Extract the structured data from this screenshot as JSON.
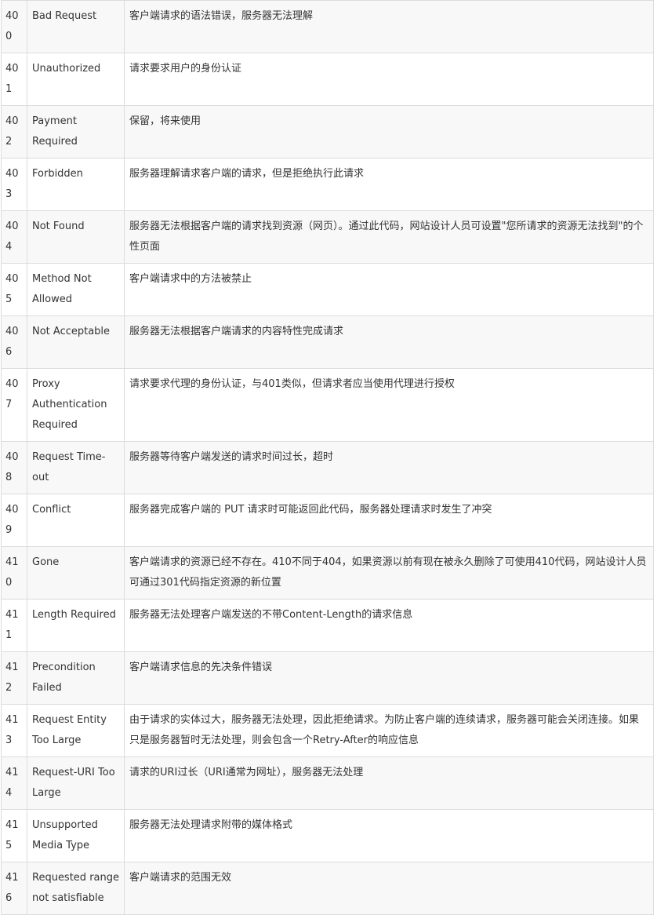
{
  "rows": [
    {
      "code": "400",
      "name": "Bad Request",
      "desc": "客户端请求的语法错误，服务器无法理解"
    },
    {
      "code": "401",
      "name": "Unauthorized",
      "desc": "请求要求用户的身份认证"
    },
    {
      "code": "402",
      "name": "Payment Required",
      "desc": "保留，将来使用"
    },
    {
      "code": "403",
      "name": "Forbidden",
      "desc": "服务器理解请求客户端的请求，但是拒绝执行此请求"
    },
    {
      "code": "404",
      "name": "Not Found",
      "desc": "服务器无法根据客户端的请求找到资源（网页）。通过此代码，网站设计人员可设置\"您所请求的资源无法找到\"的个性页面"
    },
    {
      "code": "405",
      "name": "Method Not Allowed",
      "desc": "客户端请求中的方法被禁止"
    },
    {
      "code": "406",
      "name": "Not Acceptable",
      "desc": "服务器无法根据客户端请求的内容特性完成请求"
    },
    {
      "code": "407",
      "name": "Proxy Authentication Required",
      "desc": "请求要求代理的身份认证，与401类似，但请求者应当使用代理进行授权"
    },
    {
      "code": "408",
      "name": "Request Time-out",
      "desc": "服务器等待客户端发送的请求时间过长，超时"
    },
    {
      "code": "409",
      "name": "Conflict",
      "desc": "服务器完成客户端的 PUT 请求时可能返回此代码，服务器处理请求时发生了冲突"
    },
    {
      "code": "410",
      "name": "Gone",
      "desc": "客户端请求的资源已经不存在。410不同于404，如果资源以前有现在被永久删除了可使用410代码，网站设计人员可通过301代码指定资源的新位置"
    },
    {
      "code": "411",
      "name": "Length Required",
      "desc": "服务器无法处理客户端发送的不带Content-Length的请求信息"
    },
    {
      "code": "412",
      "name": "Precondition Failed",
      "desc": "客户端请求信息的先决条件错误"
    },
    {
      "code": "413",
      "name": "Request Entity Too Large",
      "desc": "由于请求的实体过大，服务器无法处理，因此拒绝请求。为防止客户端的连续请求，服务器可能会关闭连接。如果只是服务器暂时无法处理，则会包含一个Retry-After的响应信息"
    },
    {
      "code": "414",
      "name": "Request-URI Too Large",
      "desc": "请求的URI过长（URI通常为网址），服务器无法处理"
    },
    {
      "code": "415",
      "name": "Unsupported Media Type",
      "desc": "服务器无法处理请求附带的媒体格式"
    },
    {
      "code": "416",
      "name": "Requested range not satisfiable",
      "desc": "客户端请求的范围无效"
    }
  ]
}
